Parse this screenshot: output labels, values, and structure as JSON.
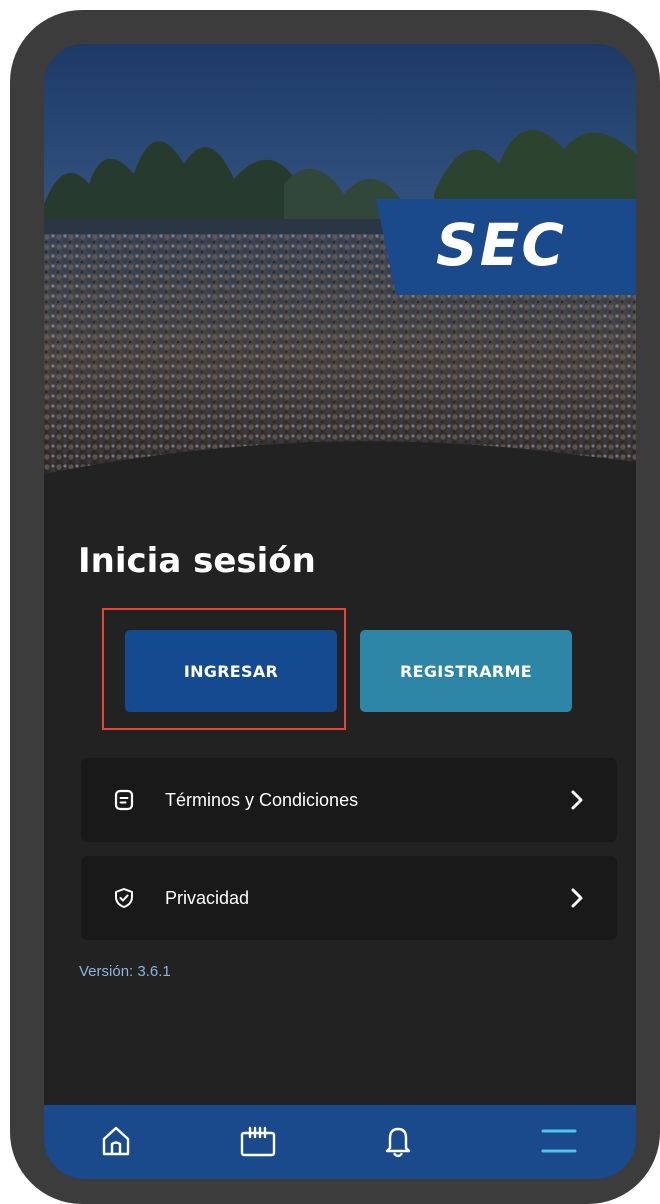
{
  "hero": {
    "logo_text": "SEC",
    "icon": "crowd-photo"
  },
  "login": {
    "title": "Inicia sesión",
    "ingresar_label": "INGRESAR",
    "registrarme_label": "REGISTRARME"
  },
  "list": {
    "items": [
      {
        "label": "Términos y Condiciones",
        "icon": "document-icon"
      },
      {
        "label": "Privacidad",
        "icon": "shield-check-icon"
      }
    ]
  },
  "version_text": "Versión: 3.6.1",
  "nav": {
    "items": [
      {
        "icon": "home-icon"
      },
      {
        "icon": "calendar-icon"
      },
      {
        "icon": "bell-icon"
      },
      {
        "icon": "menu-icon"
      }
    ]
  },
  "colors": {
    "background": "#222222",
    "primary": "#144a8f",
    "secondary": "#2e86a6",
    "nav": "#1b4a8c",
    "highlight": "#e2463b",
    "version": "#8fb2de"
  }
}
